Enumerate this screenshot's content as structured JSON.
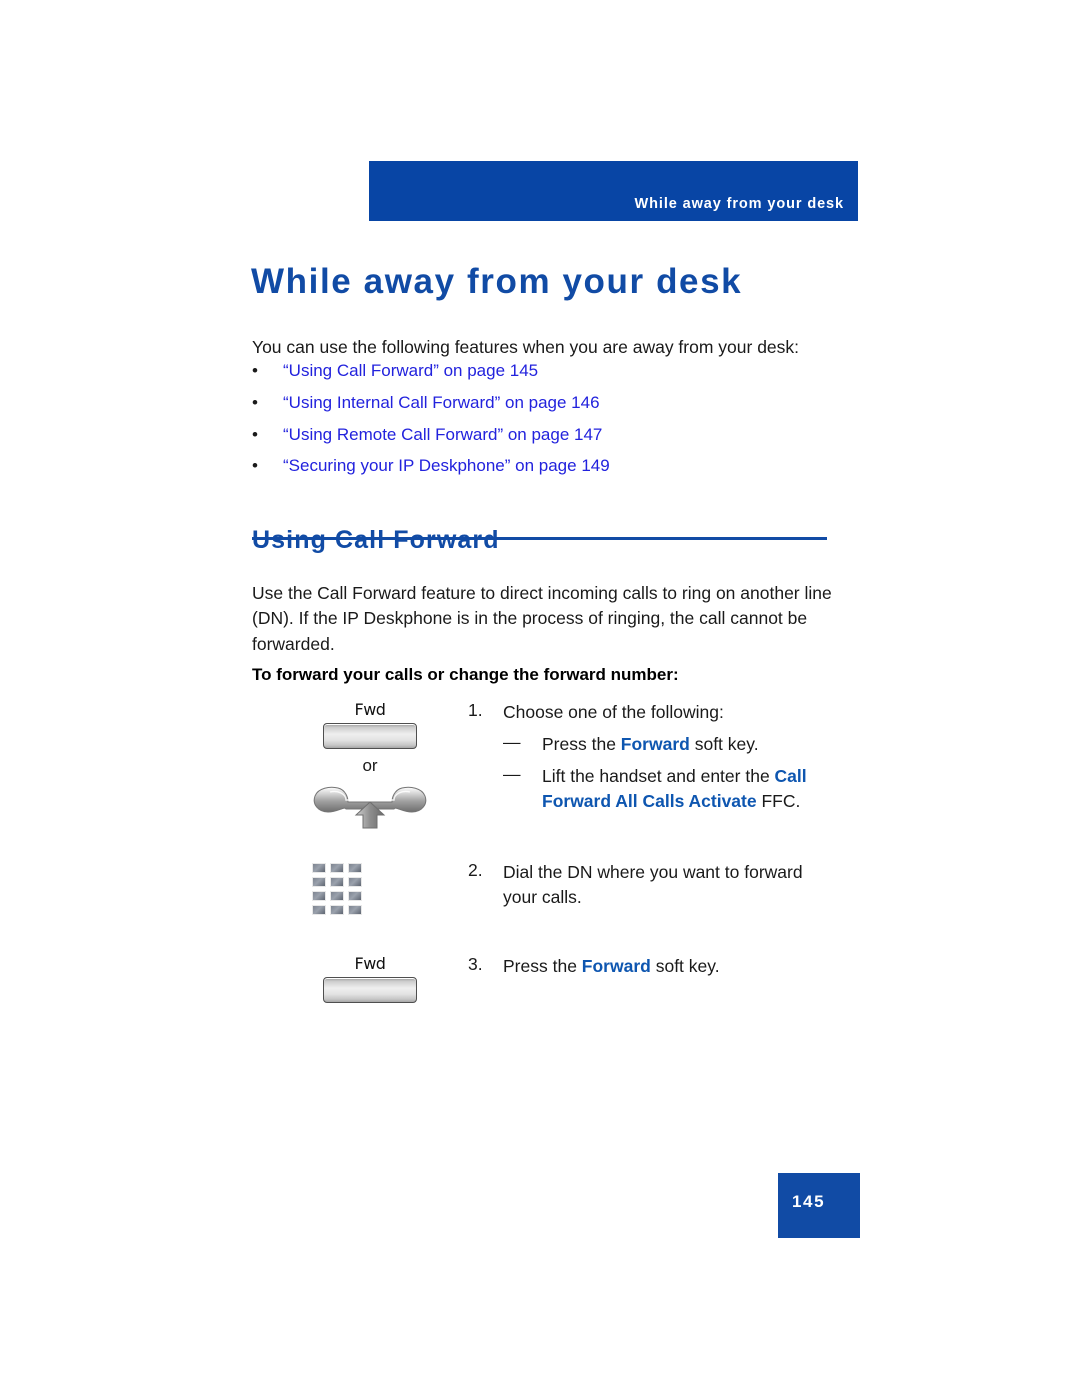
{
  "header": {
    "running_head": "While away from your desk",
    "bar_color": "#0845a5"
  },
  "chapter": {
    "title": "While away from your desk",
    "title_color": "#114ba5"
  },
  "intro": {
    "paragraph": "You can use the following features when you are away from your desk:"
  },
  "cross_references": {
    "link_color": "#2222dd",
    "bullet_glyph": "•",
    "items": [
      {
        "label": "“Using Call Forward” on page 145"
      },
      {
        "label": "“Using Internal Call Forward” on page 146"
      },
      {
        "label": "“Using Remote Call Forward” on page 147"
      },
      {
        "label": "“Securing your IP Deskphone” on page 149"
      }
    ]
  },
  "section": {
    "heading": "Using Call Forward",
    "body": "Use the Call Forward feature to direct incoming calls to ring on another line (DN). If the IP Deskphone is in the process of ringing, the call cannot be forwarded.",
    "lead_in": "To forward your calls or change the forward number:"
  },
  "procedure": {
    "keyword_color": "#0e56b0",
    "or_label": "or",
    "softkey_label": "Fwd",
    "steps": [
      {
        "number": "1.",
        "text": "Choose one of the following:",
        "substeps": [
          {
            "dash": "—",
            "prefix": "Press the ",
            "keyword": "Forward",
            "suffix": " soft key."
          },
          {
            "dash": "—",
            "prefix": "Lift the handset and enter the ",
            "keyword": "Call Forward All Calls Activate",
            "suffix": " FFC."
          }
        ]
      },
      {
        "number": "2.",
        "text": "Dial the DN where you want to forward your calls."
      },
      {
        "number": "3.",
        "prefix": "Press the ",
        "keyword": "Forward",
        "suffix": " soft key."
      }
    ]
  },
  "footer": {
    "page_number": "145",
    "block_color": "#114ba5"
  }
}
